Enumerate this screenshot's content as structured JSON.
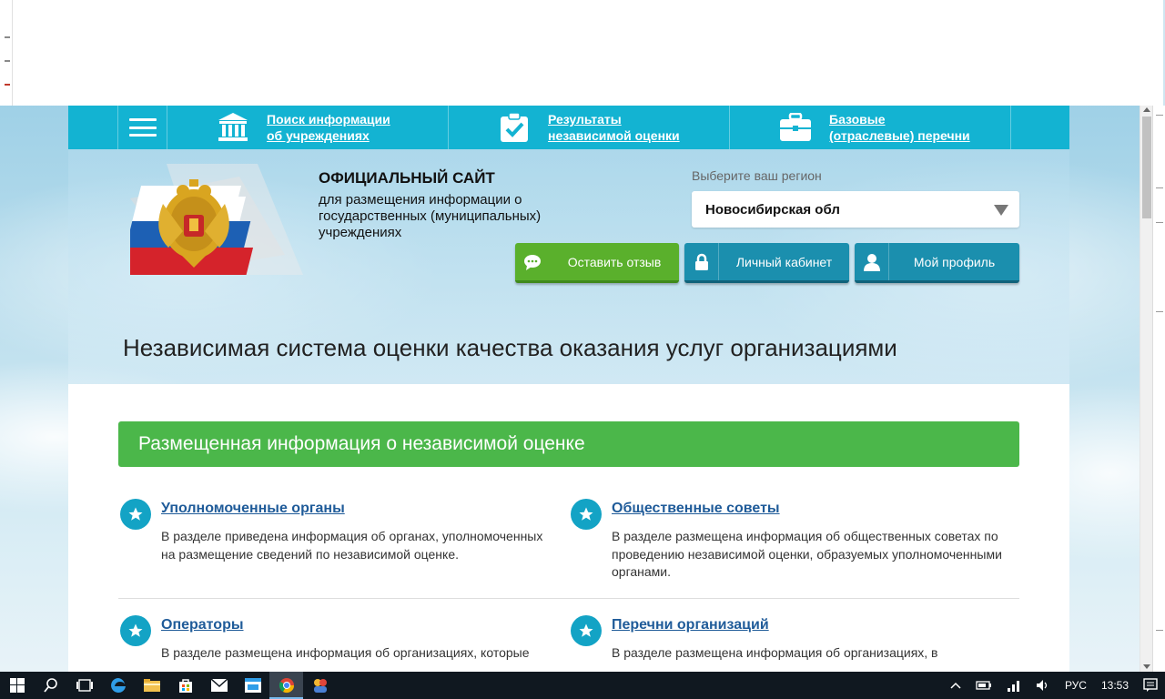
{
  "nav": {
    "items": [
      {
        "icon": "building-icon",
        "line1": "Поиск информации",
        "line2": "об учреждениях"
      },
      {
        "icon": "clipboard-check-icon",
        "line1": "Результаты",
        "line2": "независимой оценки"
      },
      {
        "icon": "briefcase-icon",
        "line1": "Базовые",
        "line2": "(отраслевые) перечни"
      }
    ]
  },
  "header": {
    "site_title": "ОФИЦИАЛЬНЫЙ САЙТ",
    "site_sub": "для размещения информации о государственных (муниципальных) учреждениях",
    "region_label": "Выберите ваш регион",
    "region_value": "Новосибирская обл",
    "buttons": {
      "feedback": "Оставить отзыв",
      "cabinet": "Личный кабинет",
      "profile": "Мой профиль"
    },
    "hero_title": "Независимая система оценки качества оказания услуг организациями"
  },
  "main": {
    "banner": "Размещенная информация о независимой оценке",
    "cards": [
      {
        "title": "Уполномоченные органы",
        "desc": "В разделе приведена информация об органах, уполномоченных на размещение сведений по независимой оценке."
      },
      {
        "title": "Общественные советы",
        "desc": "В разделе размещена информация об общественных советах по проведению независимой оценки, образуемых уполномоченными органами."
      },
      {
        "title": "Операторы",
        "desc": "В разделе размещена информация об организациях, которые"
      },
      {
        "title": "Перечни организаций",
        "desc": "В разделе размещена информация об организациях, в"
      }
    ]
  },
  "taskbar": {
    "lang": "РУС",
    "time": "13:53"
  },
  "colors": {
    "nav": "#13b3d2",
    "banner": "#4bb74a",
    "feedback_button": "#5ab02c",
    "teal_button": "#1b8fae",
    "link": "#1f5b99",
    "star": "#13a3c5"
  }
}
